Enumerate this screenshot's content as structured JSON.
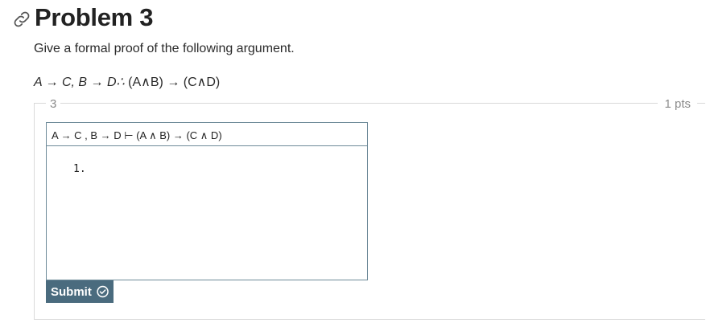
{
  "problem": {
    "title": "Problem 3",
    "prompt": "Give a formal proof of the following argument.",
    "argument": {
      "prem1": "A → C, B → D",
      "therefore": "∴",
      "conclusion": " (A∧B) → (C∧D)"
    }
  },
  "question": {
    "number": "3",
    "points": "1 pts",
    "proof_header": "A → C , B → D ⊢ (A ∧ B) → (C ∧ D)",
    "first_line": "1.",
    "submit_label": "Submit"
  },
  "colors": {
    "submit_bg": "#4a6b7e",
    "box_border": "#6e8a99"
  },
  "icons": [
    "link-icon",
    "check-circle-icon"
  ]
}
